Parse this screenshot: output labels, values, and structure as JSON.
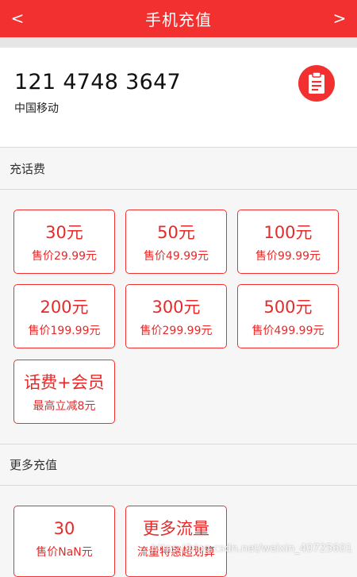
{
  "header": {
    "title": "手机充值",
    "back_label": "<",
    "forward_label": ">"
  },
  "account": {
    "phone_number": "121 4748 3647",
    "carrier": "中国移动",
    "contact_icon": "clipboard-icon"
  },
  "sections": {
    "topup": {
      "title": "充话费",
      "items": [
        {
          "amount": "30元",
          "price": "售价29.99元"
        },
        {
          "amount": "50元",
          "price": "售价49.99元"
        },
        {
          "amount": "100元",
          "price": "售价99.99元"
        },
        {
          "amount": "200元",
          "price": "售价199.99元"
        },
        {
          "amount": "300元",
          "price": "售价299.99元"
        },
        {
          "amount": "500元",
          "price": "售价499.99元"
        },
        {
          "amount": "话费+会员",
          "price": "最高立减8元"
        }
      ]
    },
    "more": {
      "title": "更多充值",
      "items": [
        {
          "amount": "30",
          "price": "售价NaN元"
        },
        {
          "amount": "更多流量",
          "price": "流量特惠超划算"
        }
      ]
    }
  },
  "watermark": "https://blog.csdn.net/weixin_40725601",
  "colors": {
    "accent": "#f23030",
    "background": "#f6f6f6"
  }
}
